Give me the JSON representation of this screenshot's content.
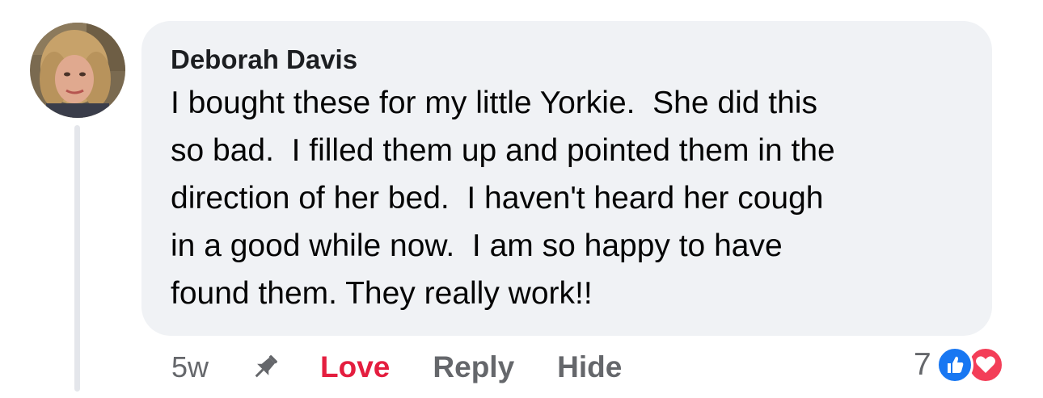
{
  "comment": {
    "author": "Deborah Davis",
    "text": "I bought these for my little Yorkie.  She did this\nso bad.  I filled them up and pointed them in the\ndirection of her bed.  I haven't heard her cough\nin a good while now.  I am so happy to have\nfound them. They really work!!",
    "time": "5w"
  },
  "actions": {
    "pin_icon": "pin-icon",
    "love_label": "Love",
    "reply_label": "Reply",
    "hide_label": "Hide"
  },
  "reactions": {
    "count": "7",
    "types": [
      "like",
      "love"
    ]
  },
  "colors": {
    "bubble_bg": "#f0f2f5",
    "love_active": "#e41e3f",
    "like_blue": "#1877f2",
    "love_red": "#f33e58",
    "muted_text": "#65676b"
  }
}
